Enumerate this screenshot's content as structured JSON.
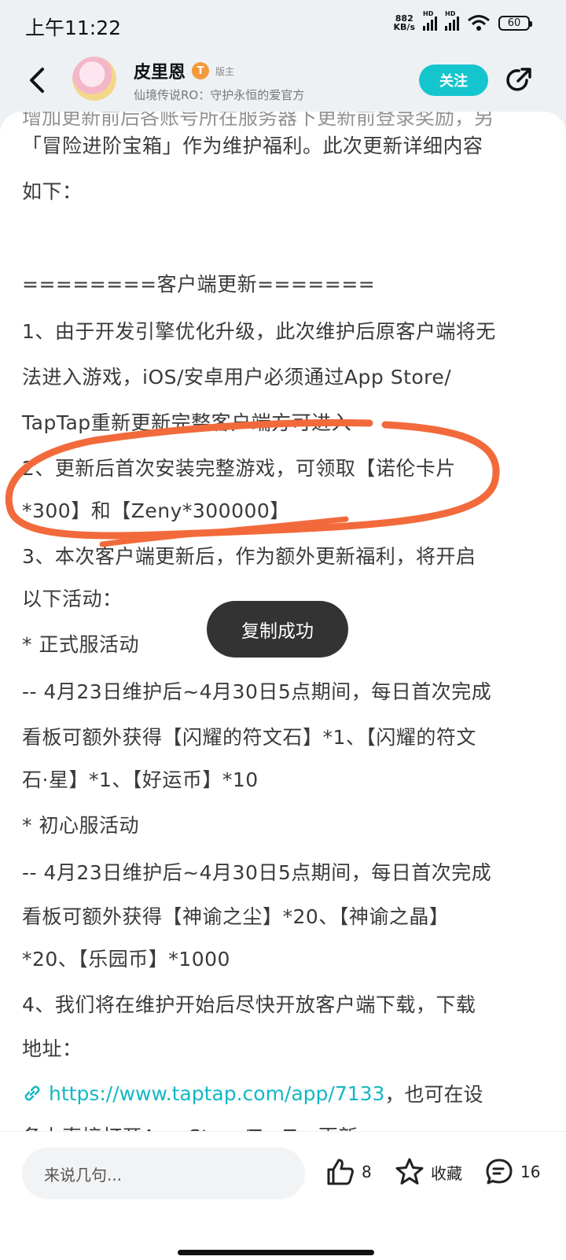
{
  "status_bar": {
    "time": "上午11:22",
    "net_speed_value": "882",
    "net_speed_unit": "KB/s",
    "hd_label": "HD",
    "battery": "60"
  },
  "header": {
    "author": "皮里恩",
    "level_badge": "T",
    "role": "版主",
    "subtitle": "仙境传说RO：守护永恒的爱官方",
    "follow_label": "关注"
  },
  "post": {
    "cut_line": "增加更新前后各账号所在服务器下更新前登录奖励，另",
    "lines": [
      "「冒险进阶宝箱」作为维护福利。此次更新详细内容",
      "如下：",
      "",
      "========客户端更新=======",
      "1、由于开发引擎优化升级，此次维护后原客户端将无",
      "法进入游戏，iOS/安卓用户必须通过App Store/",
      "TapTap重新更新完整客户端方可进入",
      "2、更新后首次安装完整游戏，可领取【诺伦卡片",
      "*300】和【Zeny*300000】",
      "3、本次客户端更新后，作为额外更新福利，将开启",
      "以下活动：",
      "* 正式服活动",
      "-- 4月23日维护后~4月30日5点期间，每日首次完成",
      "看板可额外获得【闪耀的符文石】*1、【闪耀的符文",
      "石·星】*1、【好运币】*10",
      "* 初心服活动",
      "-- 4月23日维护后~4月30日5点期间，每日首次完成",
      "看板可额外获得【神谕之尘】*20、【神谕之晶】",
      "*20、【乐园币】*1000",
      "4、我们将在维护开始后尽快开放客户端下载，下载",
      "地址："
    ],
    "link_url": "https://www.taptap.com/app/7133",
    "link_suffix": "，也可在设",
    "last_line": "备上直接打开App Store/TapTap更新"
  },
  "toast": "复制成功",
  "bottom_bar": {
    "comment_placeholder": "来说几句...",
    "like_count": "8",
    "favorite_label": "收藏",
    "comment_count": "16"
  },
  "colors": {
    "accent": "#15c5ce",
    "link": "#15b7c3",
    "annotation": "#f26a3b",
    "badge": "#f29a3c"
  }
}
